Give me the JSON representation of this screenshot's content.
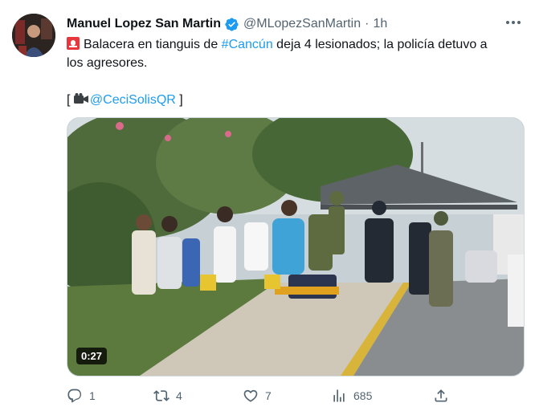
{
  "author": {
    "name": "Manuel Lopez San Martin",
    "handle": "@MLopezSanMartin",
    "separator": "·",
    "time": "1h"
  },
  "tweet": {
    "line1_before": "Balacera en tianguis de ",
    "hashtag": "#Cancún",
    "line1_after": " deja 4 lesionados; la policía detuvo a",
    "line2": "los agresores.",
    "credit_open": "[",
    "credit_mention": "@CeciSolisQR",
    "credit_close": " ]"
  },
  "media": {
    "duration": "0:27"
  },
  "actions": {
    "replies": "1",
    "retweets": "4",
    "likes": "7",
    "views": "685"
  },
  "colors": {
    "link": "#1d9bf0",
    "muted": "#536471",
    "verified": "#1d9bf0"
  },
  "icons": [
    "siren-icon",
    "camera-icon",
    "verified-badge-icon",
    "more-icon",
    "reply-icon",
    "retweet-icon",
    "like-icon",
    "views-icon",
    "share-icon"
  ]
}
